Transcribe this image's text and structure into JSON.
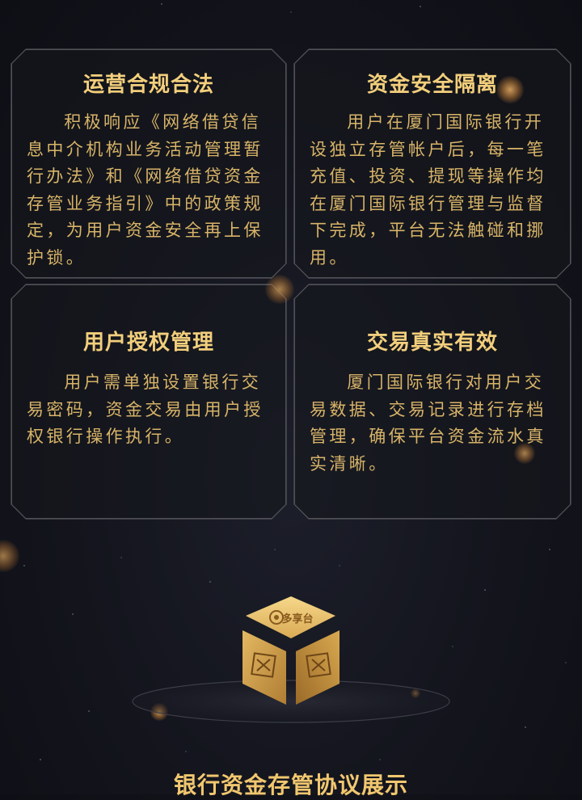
{
  "cards": [
    {
      "title": "运营合规合法",
      "body": "积极响应《网络借贷信息中介机构业务活动管理暂行办法》和《网络借贷资金存管业务指引》中的政策规定，为用户资金安全再上保护锁。"
    },
    {
      "title": "资金安全隔离",
      "body": "用户在厦门国际银行开设独立存管帐户后，每一笔充值、投资、提现等操作均在厦门国际银行管理与监督下完成，平台无法触碰和挪用。"
    },
    {
      "title": "用户授权管理",
      "body": "用户需单独设置银行交易密码，资金交易由用户授权银行操作执行。"
    },
    {
      "title": "交易真实有效",
      "body": "厦门国际银行对用户交易数据、交易记录进行存档管理，确保平台资金流水真实清晰。"
    }
  ],
  "box": {
    "brand_text": "多享台",
    "icon": "gold-cube-logo-icon"
  },
  "footer": {
    "title": "银行资金存管协议展示"
  },
  "colors": {
    "background": "#13141c",
    "gold": "#f3cf7c",
    "body_text": "#d8b468",
    "border": "#4a4a4f"
  }
}
